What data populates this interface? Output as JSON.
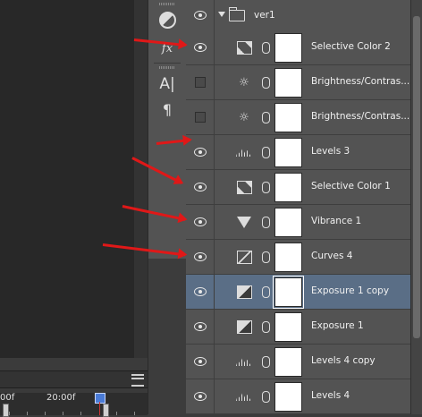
{
  "timeline": {
    "tick_label_1": "00f",
    "tick_label_2": "20:00f"
  },
  "tools": [
    "adjustments-icon",
    "fx-icon",
    "character-icon",
    "paragraph-icon"
  ],
  "tool_labels": {
    "fx": "fx",
    "character": "A|",
    "paragraph": "¶"
  },
  "layers": {
    "group_name": "ver1",
    "rows": [
      {
        "name": "Selective Color 2",
        "icon": "selective-color-icon",
        "visible": true
      },
      {
        "name": "Brightness/Contras...",
        "icon": "brightness-icon",
        "visible": false
      },
      {
        "name": "Brightness/Contras...",
        "icon": "brightness-icon",
        "visible": false
      },
      {
        "name": "Levels 3",
        "icon": "levels-icon",
        "visible": true
      },
      {
        "name": "Selective Color 1",
        "icon": "selective-color-icon",
        "visible": true
      },
      {
        "name": "Vibrance 1",
        "icon": "vibrance-icon",
        "visible": true
      },
      {
        "name": "Curves 4",
        "icon": "curves-icon",
        "visible": true
      },
      {
        "name": "Exposure 1 copy",
        "icon": "exposure-icon",
        "visible": true,
        "selected": true
      },
      {
        "name": "Exposure 1",
        "icon": "exposure-icon",
        "visible": true
      },
      {
        "name": "Levels 4 copy",
        "icon": "levels-icon",
        "visible": true
      },
      {
        "name": "Levels 4",
        "icon": "levels-icon",
        "visible": true
      }
    ]
  },
  "colors": {
    "panel": "#535353",
    "selected_row": "#5a6e86",
    "annotation_arrow": "#e01818"
  }
}
